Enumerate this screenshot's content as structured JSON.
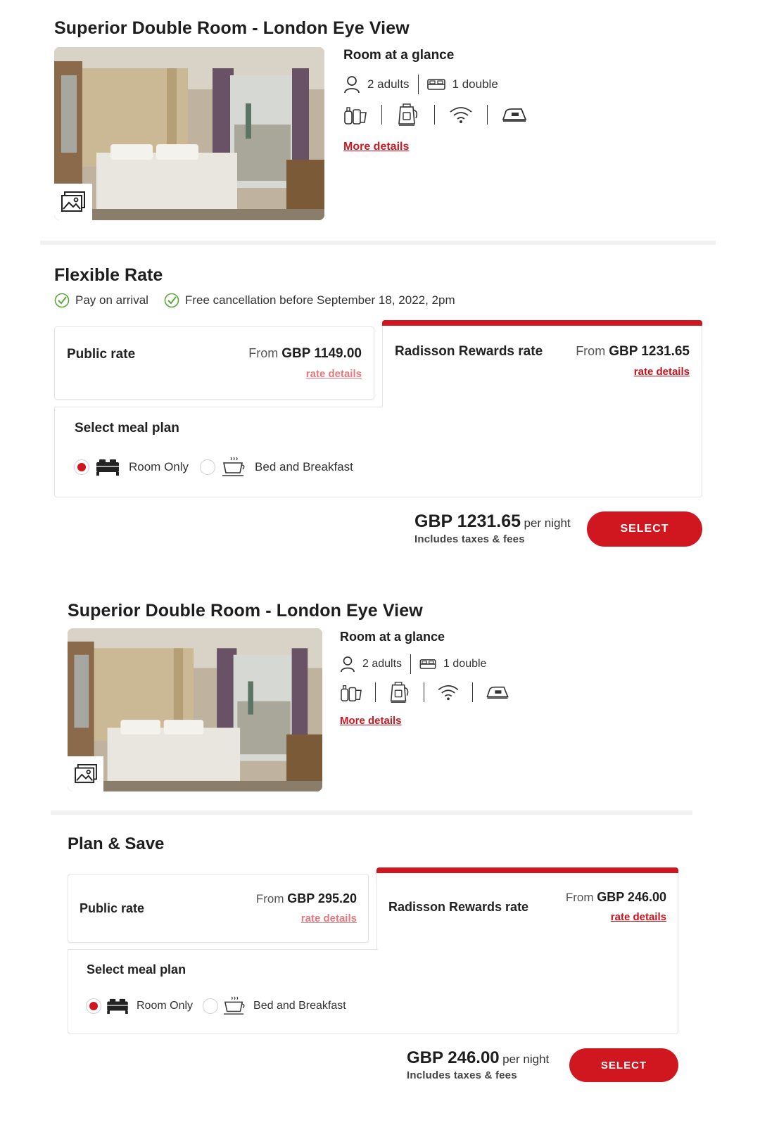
{
  "rooms": [
    {
      "title": "Superior Double Room - London Eye View",
      "glance": {
        "title": "Room at a glance",
        "adults": "2 adults",
        "bed": "1 double",
        "amenities": [
          "toiletries-icon",
          "kettle-icon",
          "wifi-icon",
          "iron-icon"
        ],
        "more_details": "More details"
      },
      "rate_plan": {
        "name": "Flexible Rate",
        "policies": [
          "Pay on arrival",
          "Free cancellation before September 18, 2022, 2pm"
        ],
        "public": {
          "label": "Public rate",
          "from": "From",
          "price": "GBP 1149.00",
          "details": "rate details"
        },
        "rewards": {
          "label": "Radisson Rewards rate",
          "from": "From",
          "price": "GBP 1231.65",
          "details": "rate details"
        },
        "meal": {
          "title": "Select meal plan",
          "options": [
            {
              "label": "Room Only",
              "icon": "bed-icon",
              "selected": true
            },
            {
              "label": "Bed and Breakfast",
              "icon": "coffee-cup-icon",
              "selected": false
            }
          ]
        },
        "total": {
          "amount": "GBP 1231.65",
          "per": "per night",
          "taxes": "Includes taxes & fees"
        },
        "select_label": "SELECT"
      }
    },
    {
      "title": "Superior Double Room - London Eye View",
      "glance": {
        "title": "Room at a glance",
        "adults": "2 adults",
        "bed": "1 double",
        "amenities": [
          "toiletries-icon",
          "kettle-icon",
          "wifi-icon",
          "iron-icon"
        ],
        "more_details": "More details"
      },
      "rate_plan": {
        "name": "Plan & Save",
        "public": {
          "label": "Public rate",
          "from": "From",
          "price": "GBP 295.20",
          "details": "rate details"
        },
        "rewards": {
          "label": "Radisson Rewards rate",
          "from": "From",
          "price": "GBP 246.00",
          "details": "rate details"
        },
        "meal": {
          "title": "Select meal plan",
          "options": [
            {
              "label": "Room Only",
              "icon": "bed-icon",
              "selected": true
            },
            {
              "label": "Bed and Breakfast",
              "icon": "coffee-cup-icon",
              "selected": false
            }
          ]
        },
        "total": {
          "amount": "GBP 246.00",
          "per": "per night",
          "taxes": "Includes taxes & fees"
        },
        "select_label": "SELECT"
      }
    }
  ],
  "colors": {
    "accent": "#d0161e",
    "check": "#5aa83a",
    "text": "#1e1e1e"
  }
}
